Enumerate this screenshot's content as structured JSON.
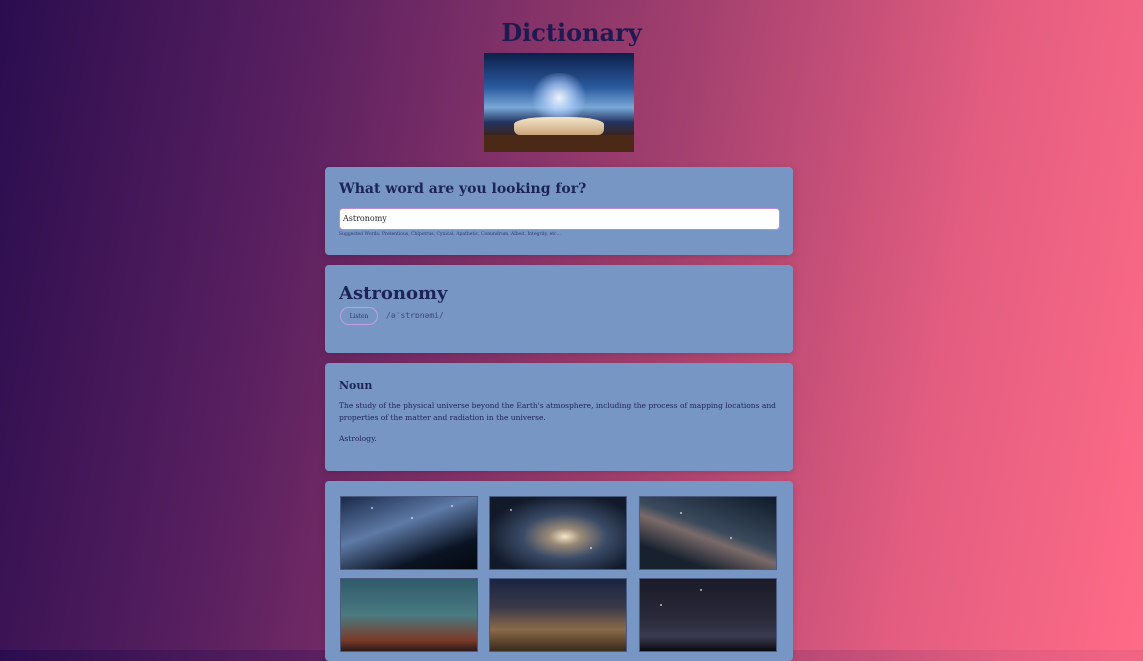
{
  "app": {
    "title": "Dictionary"
  },
  "search": {
    "question": "What word are you looking for?",
    "value": "Astronomy",
    "suggestions": "Suggested Words: Pretentious, Chlpotrus, Cynical, Apathetic, Conundrum, Albeit, Integrity, etc..."
  },
  "word": {
    "title": "Astronomy",
    "listen_label": "Listen",
    "phonetic": "/əˈstrɒnəmi/"
  },
  "meaning": {
    "part_of_speech": "Noun",
    "definition": "The study of the physical universe beyond the Earth's atmosphere, including the process of mapping locations and properties of the matter and radiation in the universe.",
    "synonym": "Astrology."
  },
  "icons": {
    "hero": "open-book-galaxy-image",
    "photos": [
      "telescope-photo",
      "galaxy-photo",
      "milky-way-photo",
      "hand-sky-photo",
      "mountain-photo",
      "stargazers-photo"
    ]
  }
}
